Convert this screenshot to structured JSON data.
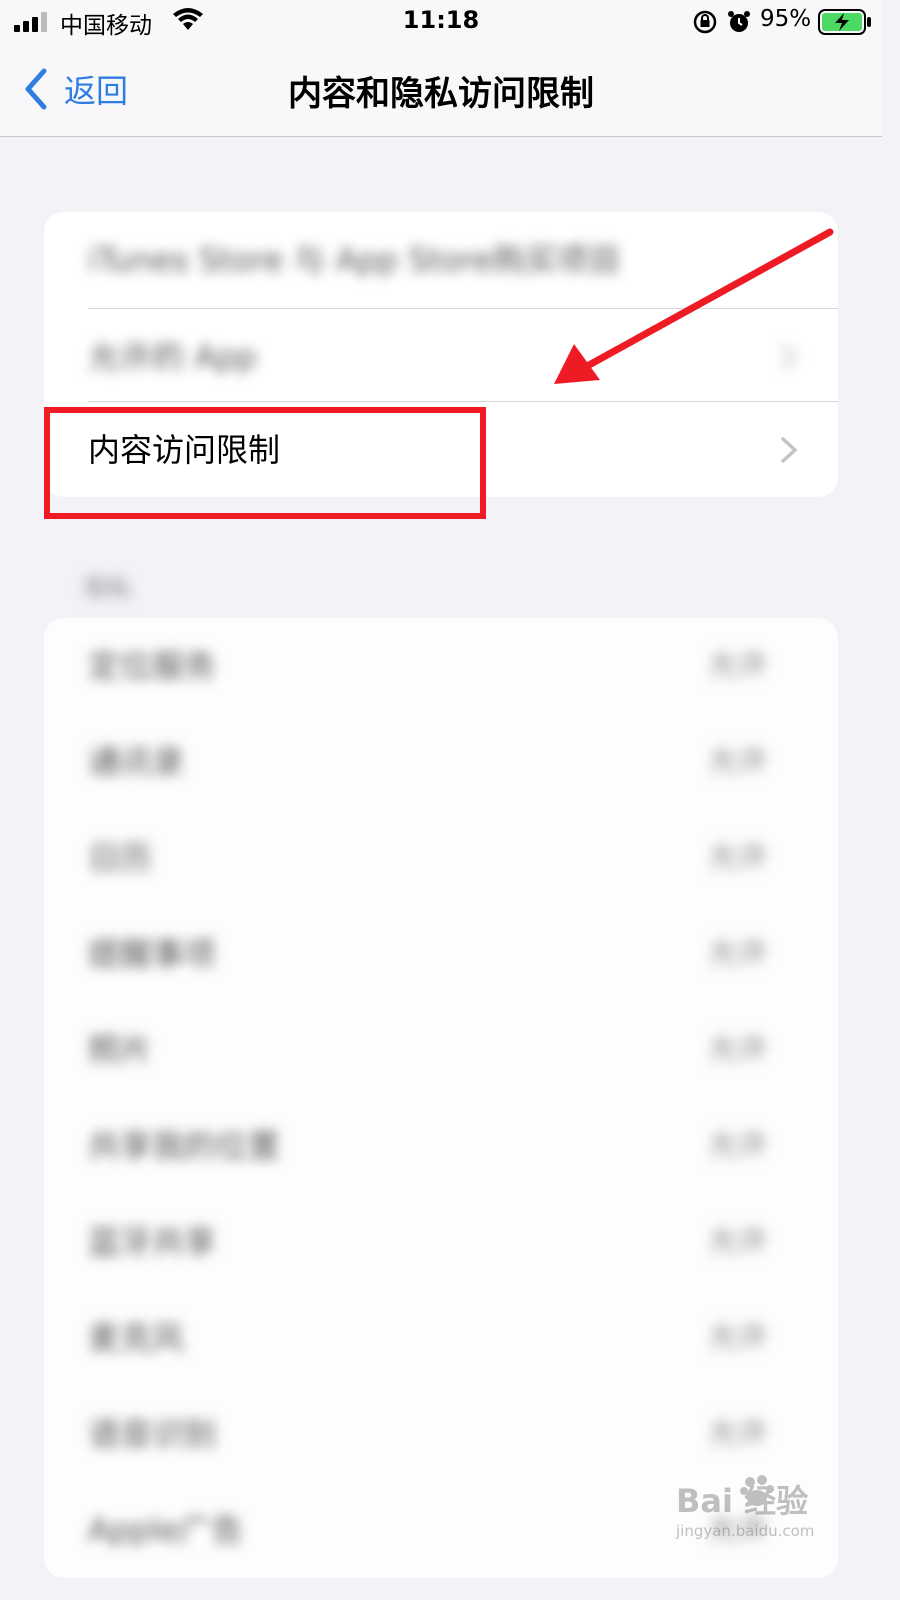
{
  "status_bar": {
    "carrier": "中国移动",
    "time": "11:18",
    "battery_percent": "95%",
    "icons": [
      "signal-icon",
      "wifi-icon",
      "rotation-lock-icon",
      "alarm-icon",
      "battery-charging-icon"
    ]
  },
  "nav": {
    "back_label": "返回",
    "title": "内容和隐私访问限制"
  },
  "group1": {
    "items": [
      {
        "label": "iTunes Store 与 App Store购买项目",
        "blurred": true
      },
      {
        "label": "允许的 App",
        "blurred": true
      },
      {
        "label": "内容访问限制",
        "blurred": false
      }
    ]
  },
  "section_header": "隐私",
  "privacy_items": [
    {
      "label": "定位服务",
      "value": "允许"
    },
    {
      "label": "通讯录",
      "value": "允许"
    },
    {
      "label": "日历",
      "value": "允许"
    },
    {
      "label": "提醒事项",
      "value": "允许"
    },
    {
      "label": "照片",
      "value": "允许"
    },
    {
      "label": "共享我的位置",
      "value": "允许"
    },
    {
      "label": "蓝牙共享",
      "value": "允许"
    },
    {
      "label": "麦克风",
      "value": "允许"
    },
    {
      "label": "语音识别",
      "value": "允许"
    },
    {
      "label": "Apple广告",
      "value": "允许"
    }
  ],
  "watermark": {
    "brand": "Bai  经验",
    "url": "jingyan.baidu.com"
  },
  "colors": {
    "accent": "#2f7de1",
    "annotation_red": "#ee1b24",
    "background": "#f2f2f7"
  }
}
